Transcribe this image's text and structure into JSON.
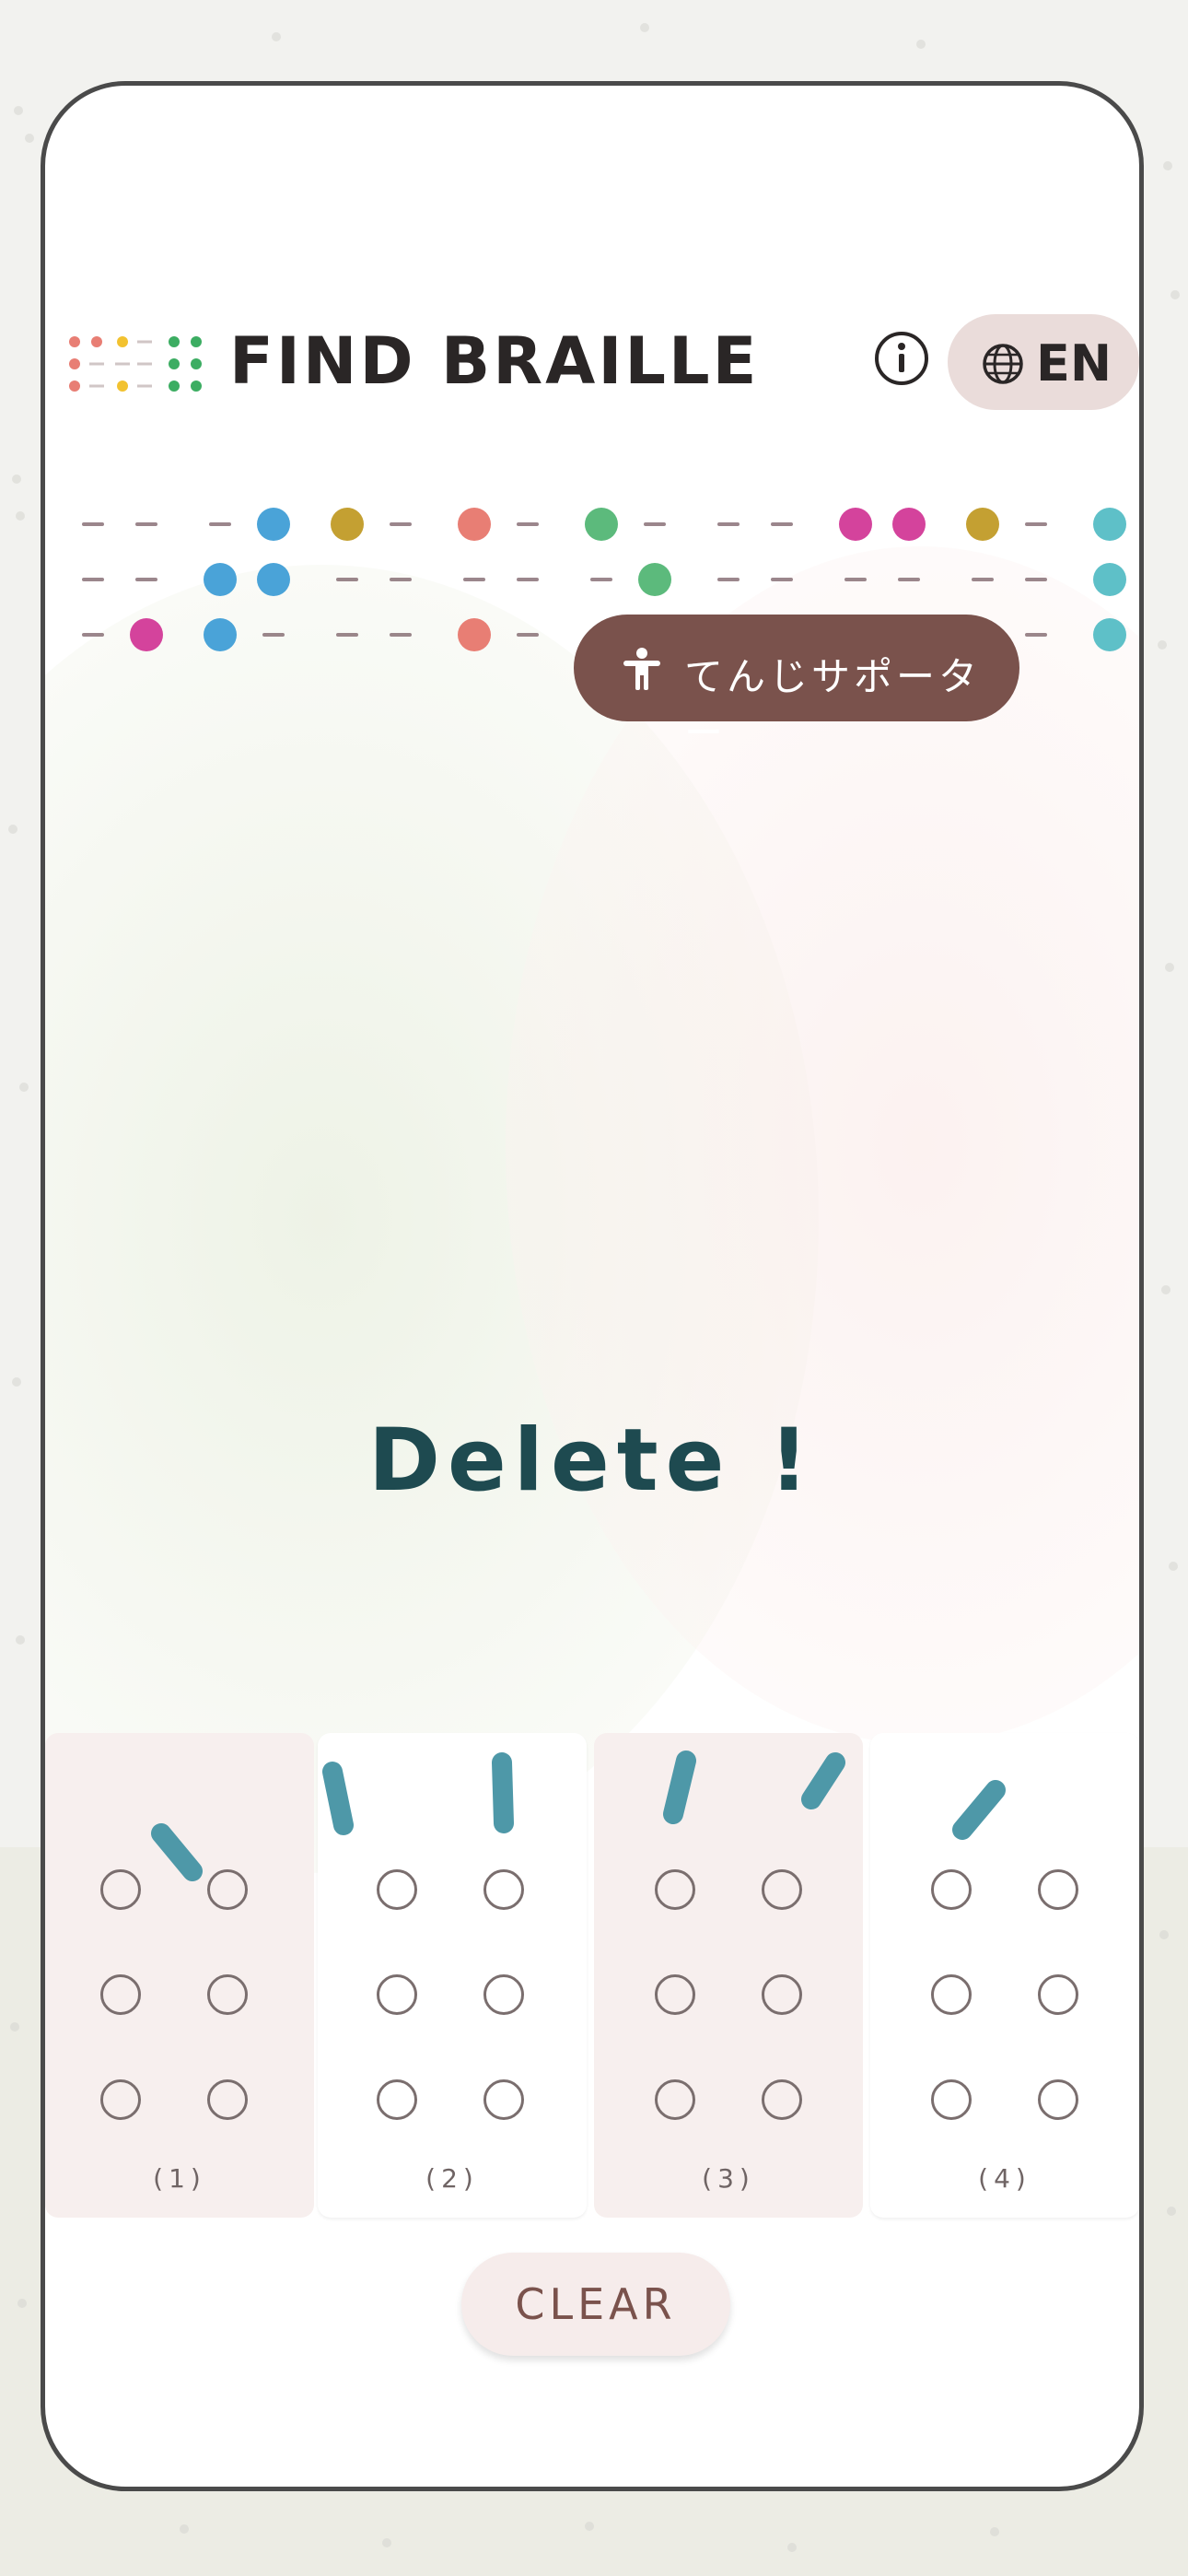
{
  "app": {
    "title": "FIND BRAILLE",
    "language_label": "EN",
    "supporter_label": "てんじサポーター",
    "message": "Delete !",
    "clear_label": "CLEAR"
  },
  "cells": [
    {
      "label": "(1)",
      "style": "pink"
    },
    {
      "label": "(2)",
      "style": "white"
    },
    {
      "label": "(3)",
      "style": "pink"
    },
    {
      "label": "(4)",
      "style": "white"
    }
  ],
  "icons": {
    "logo": "braille-logo-icon",
    "info": "info-icon",
    "language": "globe-icon",
    "supporter": "accessibility-person-icon"
  },
  "colors": {
    "accent_brown": "#7a524c",
    "message_teal": "#1e4a50",
    "stroke_teal": "#4e98a8",
    "dot_blue": "#4aa3d8",
    "dot_gold": "#c4a032",
    "dot_coral": "#e87e74",
    "dot_green": "#5cba7c",
    "dot_magenta": "#d4439c",
    "dot_cyan": "#5ec0c8"
  }
}
